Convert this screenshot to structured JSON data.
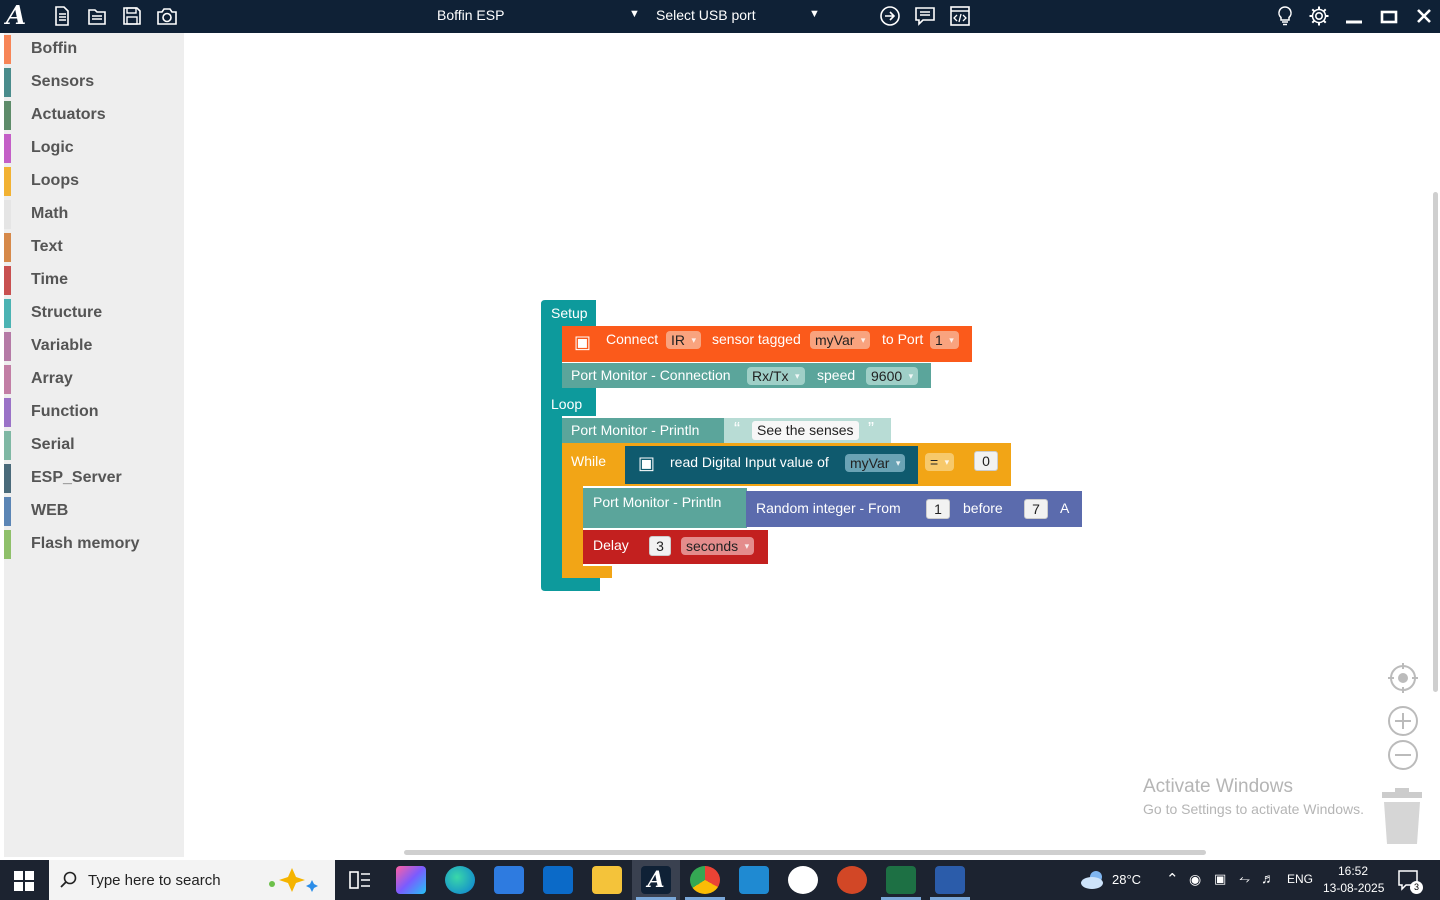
{
  "app": {
    "logo_letter": "A",
    "board_select": "Boffin ESP",
    "port_select": "Select USB port"
  },
  "toolbar_icons": [
    "new-file-icon",
    "open-file-icon",
    "save-icon",
    "camera-icon"
  ],
  "toolbar_right_icons": [
    "upload-arrow-icon",
    "message-icon",
    "code-view-icon"
  ],
  "window_icons": [
    "bulb-icon",
    "gear-icon",
    "minimize-icon",
    "maximize-icon",
    "close-icon"
  ],
  "sidebar": {
    "items": [
      {
        "label": "Boffin",
        "color": "#f78557"
      },
      {
        "label": "Sensors",
        "color": "#4a8c8c"
      },
      {
        "label": "Actuators",
        "color": "#5e8c6a"
      },
      {
        "label": "Logic",
        "color": "#c45fc7"
      },
      {
        "label": "Loops",
        "color": "#f2b233"
      },
      {
        "label": "Math",
        "color": "#e5e5e5"
      },
      {
        "label": "Text",
        "color": "#d6894a"
      },
      {
        "label": "Time",
        "color": "#c85050"
      },
      {
        "label": "Structure",
        "color": "#4bb3b3"
      },
      {
        "label": "Variable",
        "color": "#b57aa6"
      },
      {
        "label": "Array",
        "color": "#c27ea5"
      },
      {
        "label": "Function",
        "color": "#9a72c7"
      },
      {
        "label": "Serial",
        "color": "#7fb8a4"
      },
      {
        "label": "ESP_Server",
        "color": "#4a6a7a"
      },
      {
        "label": "WEB",
        "color": "#5b85b5"
      },
      {
        "label": "Flash memory",
        "color": "#8fc06a"
      }
    ]
  },
  "blocks": {
    "setup_label": "Setup",
    "loop_label": "Loop",
    "connect": {
      "t1": "Connect",
      "sensor": "IR",
      "t2": "sensor tagged",
      "var": "myVar",
      "t3": "to Port",
      "port": "1"
    },
    "port_monitor_conn": {
      "label": "Port Monitor - Connection",
      "mode": "Rx/Tx",
      "t2": "speed",
      "speed": "9600"
    },
    "println1": {
      "label": "Port Monitor - Println",
      "quote_open": "“",
      "text": "See the senses",
      "quote_close": "”"
    },
    "while": {
      "label": "While",
      "read": "read Digital Input value of",
      "var": "myVar",
      "op": "=",
      "value": "0"
    },
    "println2": {
      "label": "Port Monitor - Println",
      "random": "Random integer - From",
      "from": "1",
      "before": "before",
      "to": "7",
      "suffix": "A"
    },
    "delay": {
      "label": "Delay",
      "value": "3",
      "unit": "seconds"
    }
  },
  "watermark": {
    "line1": "Activate Windows",
    "line2": "Go to Settings to activate Windows."
  },
  "taskbar": {
    "search_placeholder": "Type here to search",
    "weather": "28°C",
    "lang": "ENG",
    "time": "16:52",
    "date": "13-08-2025",
    "notifications": "3"
  }
}
